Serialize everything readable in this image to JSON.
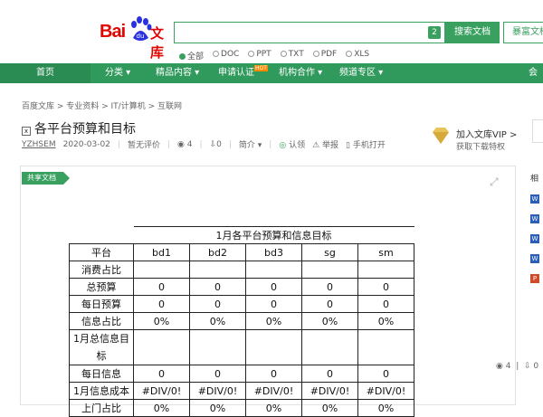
{
  "header": {
    "logo": {
      "bai": "Bai",
      "du": "du",
      "wenku": "文库"
    },
    "search": {
      "badge": "2",
      "button": "搜索文档",
      "my_docs": "暴富文档"
    },
    "types": [
      "全部",
      "DOC",
      "PPT",
      "TXT",
      "PDF",
      "XLS"
    ]
  },
  "nav": {
    "items": [
      "首页",
      "分类 ▾",
      "精品内容 ▾",
      "申请认证",
      "机构合作 ▾",
      "频道专区 ▾",
      "会"
    ],
    "hot_badge": "HOT"
  },
  "breadcrumb": "百度文库 > 专业资料 > IT/计算机 > 互联网",
  "doc": {
    "title": "各平台预算和目标",
    "author": "YZHSEM",
    "date": "2020-03-02",
    "rating": "暂无评价",
    "views": "4",
    "downloads": "0",
    "intro": "简介",
    "actions": [
      "认领",
      "举报",
      "手机打开"
    ],
    "share_badge": "共享文档",
    "expand_icon": "⤢"
  },
  "vip": {
    "title": "加入文库VIP >",
    "subtitle": "获取下载特权"
  },
  "sheet": {
    "title": "1月各平台预算和信息目标",
    "headers": [
      "平台",
      "bd1",
      "bd2",
      "bd3",
      "sg",
      "sm"
    ],
    "rows": [
      {
        "label": "消费占比",
        "values": [
          "",
          "",
          "",
          "",
          ""
        ]
      },
      {
        "label": "总预算",
        "values": [
          "0",
          "0",
          "0",
          "0",
          "0"
        ]
      },
      {
        "label": "每日预算",
        "values": [
          "0",
          "0",
          "0",
          "0",
          "0"
        ]
      },
      {
        "label": "信息占比",
        "values": [
          "0%",
          "0%",
          "0%",
          "0%",
          "0%"
        ]
      },
      {
        "label": "1月总信息目标",
        "values": [
          "",
          "",
          "",
          "",
          ""
        ]
      },
      {
        "label": "每日信息",
        "values": [
          "0",
          "0",
          "0",
          "0",
          "0"
        ]
      },
      {
        "label": "1月信息成本",
        "values": [
          "#DIV/0!",
          "#DIV/0!",
          "#DIV/0!",
          "#DIV/0!",
          "#DIV/0!"
        ]
      },
      {
        "label": "上门占比",
        "values": [
          "0%",
          "0%",
          "0%",
          "0%",
          "0%"
        ]
      }
    ]
  },
  "stats": {
    "views": "4",
    "downloads": "0"
  },
  "sidebar": {
    "label": "相",
    "icons": [
      "W",
      "W",
      "W",
      "W",
      "P"
    ]
  },
  "colors": {
    "brand_green": "#39a060",
    "nav_green": "#2f9a5c",
    "logo_red": "#e10602"
  }
}
